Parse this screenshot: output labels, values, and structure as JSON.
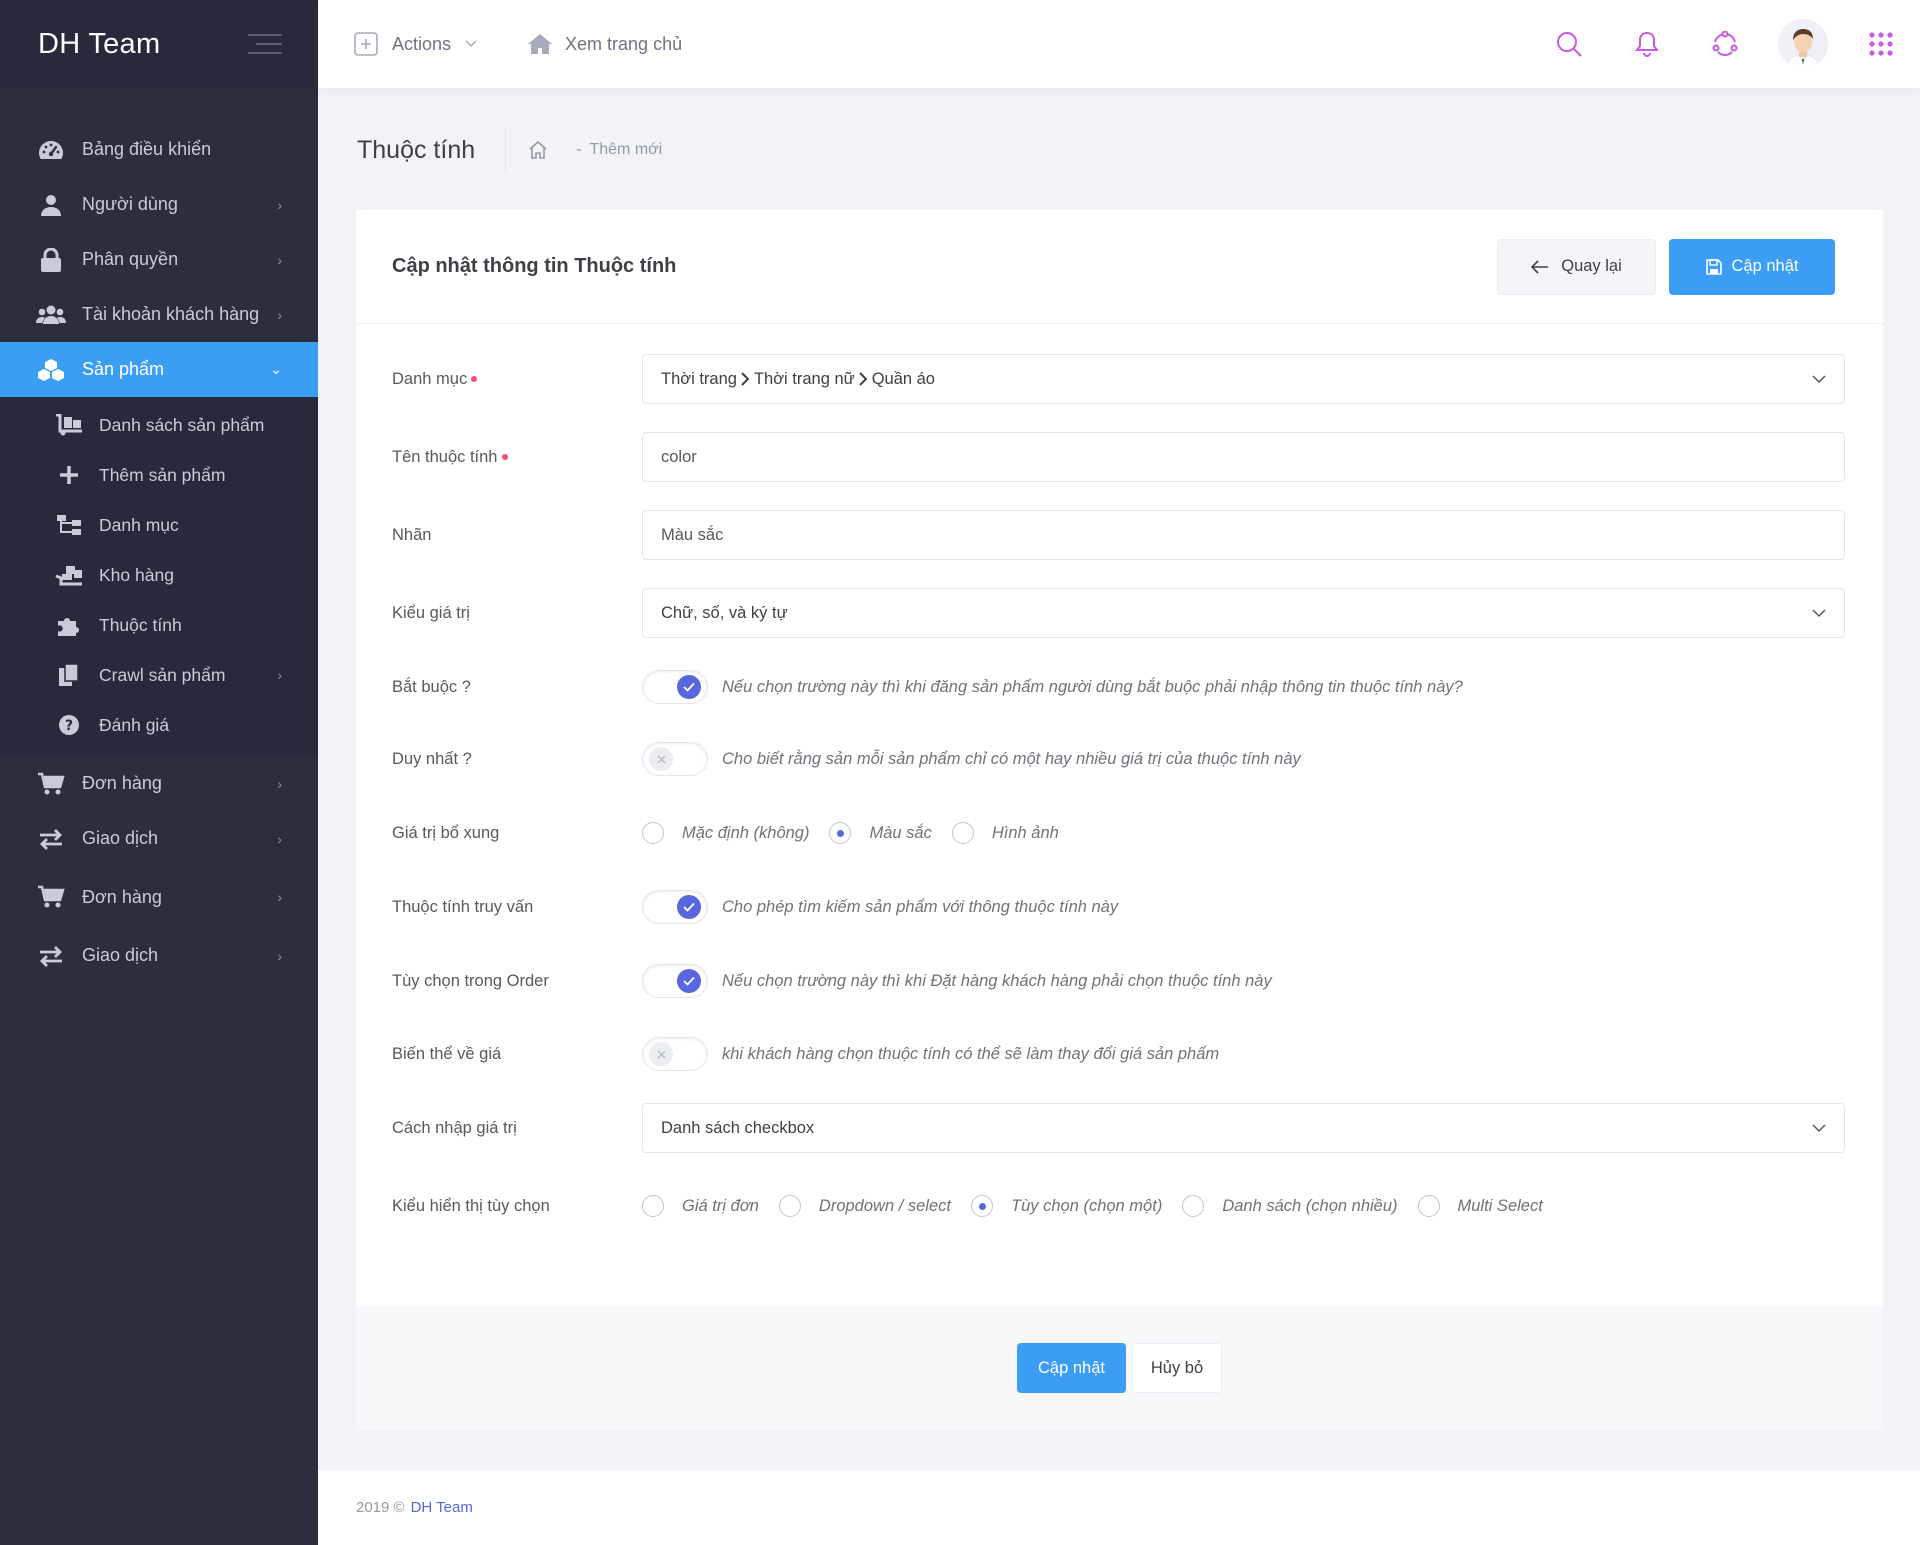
{
  "brand": {
    "name": "DH Team"
  },
  "topbar": {
    "actions_label": "Actions",
    "home_label": "Xem trang chủ",
    "icons": [
      "search-icon",
      "bell-icon",
      "share-icon",
      "user-avatar",
      "apps-grid-icon"
    ],
    "accent_color": "#c85be0"
  },
  "sidebar": {
    "items": [
      {
        "label": "Bảng điều khiển",
        "icon": "dashboard-icon"
      },
      {
        "label": "Người dùng",
        "icon": "user-icon"
      },
      {
        "label": "Phân quyền",
        "icon": "lock-icon"
      },
      {
        "label": "Tài khoản khách hàng",
        "icon": "users-icon"
      },
      {
        "label": "Sản phẩm",
        "icon": "cubes-icon",
        "active": true
      },
      {
        "label": "Đơn hàng",
        "icon": "cart-icon"
      },
      {
        "label": "Giao dịch",
        "icon": "exchange-icon"
      },
      {
        "label": "Đơn hàng",
        "icon": "cart-icon"
      },
      {
        "label": "Giao dịch",
        "icon": "exchange-icon"
      }
    ],
    "subitems": [
      {
        "label": "Danh sách sản phẩm",
        "icon": "dolly-icon"
      },
      {
        "label": "Thêm sản phẩm",
        "icon": "plus-icon"
      },
      {
        "label": "Danh mục",
        "icon": "sitemap-icon"
      },
      {
        "label": "Kho hàng",
        "icon": "warehouse-icon"
      },
      {
        "label": "Thuộc tính",
        "icon": "puzzle-icon"
      },
      {
        "label": "Crawl sản phẩm",
        "icon": "copy-icon"
      },
      {
        "label": "Đánh giá",
        "icon": "question-icon"
      }
    ]
  },
  "subheader": {
    "title": "Thuộc tính",
    "crumb": "Thêm mới"
  },
  "form": {
    "title": "Cập nhật thông tin Thuộc tính",
    "back_label": "Quay lại",
    "save_label": "Cập nhật",
    "fields": {
      "category": {
        "label": "Danh mục",
        "path": [
          "Thời trang",
          "Thời trang nữ",
          "Quần áo"
        ]
      },
      "name": {
        "label": "Tên thuộc tính",
        "value": "color"
      },
      "tag": {
        "label": "Nhãn",
        "value": "Màu sắc"
      },
      "value_type": {
        "label": "Kiểu giá trị",
        "value": "Chữ, số, và ký tự"
      },
      "required": {
        "label": "Bắt buộc ?",
        "on": true,
        "hint": "Nếu chọn trường này thì khi đăng sản phẩm người dùng bắt buộc phải nhập thông tin thuộc tính này?"
      },
      "unique": {
        "label": "Duy nhất ?",
        "on": false,
        "hint": "Cho biết rằng sản mỗi sản phẩm chỉ có một hay nhiều giá trị của thuộc tính này"
      },
      "extra": {
        "label": "Giá trị bổ xung",
        "options": [
          "Mặc định (không)",
          "Màu sắc",
          "Hình ảnh"
        ],
        "selected": 1
      },
      "query": {
        "label": "Thuộc tính truy vấn",
        "on": true,
        "hint": "Cho phép tìm kiếm sản phẩm với thông thuộc tính này"
      },
      "order_option": {
        "label": "Tùy chọn trong Order",
        "on": true,
        "hint": "Nếu chọn trường này thì khi Đặt hàng khách hàng phải chọn thuộc tính này"
      },
      "price_variant": {
        "label": "Biến thể về giá",
        "on": false,
        "hint": "khi khách hàng chọn thuộc tính có thể sẽ làm thay đổi giá sản phẩm"
      },
      "input_method": {
        "label": "Cách nhập giá trị",
        "value": "Danh sách checkbox"
      },
      "display_type": {
        "label": "Kiểu hiển thị tùy chọn",
        "options": [
          "Giá trị đơn",
          "Dropdown / select",
          "Tùy chọn (chọn một)",
          "Danh sách (chọn nhiều)",
          "Multi Select"
        ],
        "selected": 2
      }
    },
    "submit_label": "Cập nhật",
    "cancel_label": "Hủy bỏ"
  },
  "footer": {
    "year": "2019 ©",
    "link": "DH Team"
  }
}
